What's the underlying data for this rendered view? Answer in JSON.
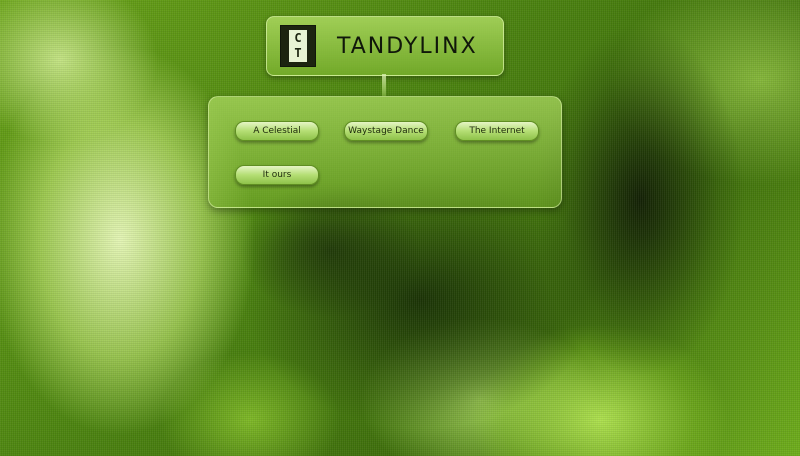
{
  "brand": {
    "logo_letters": {
      "top": "C",
      "bottom": "T"
    },
    "wordmark": "TANDYLINX"
  },
  "menu": {
    "items": [
      {
        "label": "A Celestial"
      },
      {
        "label": "Waystage Dance"
      },
      {
        "label": "The Internet"
      },
      {
        "label": "It ours"
      }
    ]
  },
  "colors": {
    "background": "#4f8a0c",
    "panel": "#a8d35a",
    "button": "#b4de74",
    "text": "#1e2a0c"
  }
}
